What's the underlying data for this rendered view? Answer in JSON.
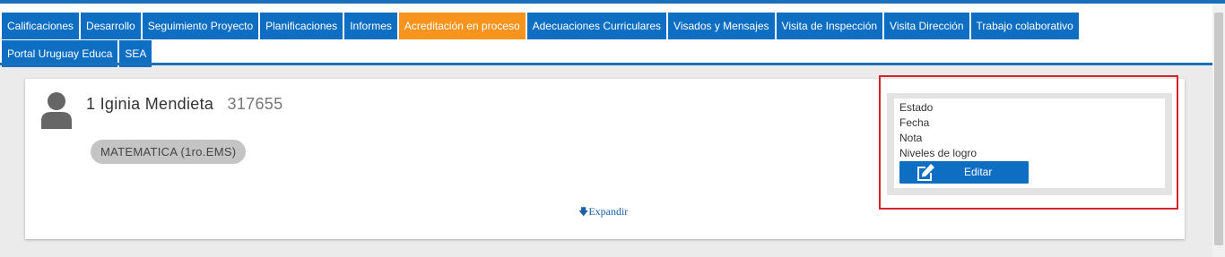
{
  "nav": {
    "row1": [
      "Calificaciones",
      "Desarrollo",
      "Seguimiento Proyecto",
      "Planificaciones",
      "Informes",
      "Acreditación en proceso",
      "Adecuaciones Curriculares",
      "Visados y Mensajes",
      "Visita de Inspección",
      "Visita Dirección",
      "Trabajo colaborativo"
    ],
    "row2": [
      "Portal Uruguay Educa",
      "SEA"
    ],
    "active_tab": "Acreditación en proceso"
  },
  "student": {
    "number": "1",
    "name": "Iginia Mendieta",
    "id": "317655",
    "subject": "MATEMATICA (1ro.EMS)"
  },
  "status_panel": {
    "estado_label": "Estado",
    "fecha_label": "Fecha",
    "nota_label": "Nota",
    "niveles_label": "Niveles de logro",
    "edit_label": "Editar"
  },
  "expand": {
    "label": "Expandir"
  },
  "colors": {
    "tab_blue": "#0d6ec2",
    "tab_active": "#f7941d",
    "highlight": "#d9222a",
    "badge_gray": "#c4c4c4"
  },
  "icons": {
    "avatar": "user-silhouette-icon",
    "expand": "arrow-down-icon",
    "edit": "edit-square-icon"
  }
}
